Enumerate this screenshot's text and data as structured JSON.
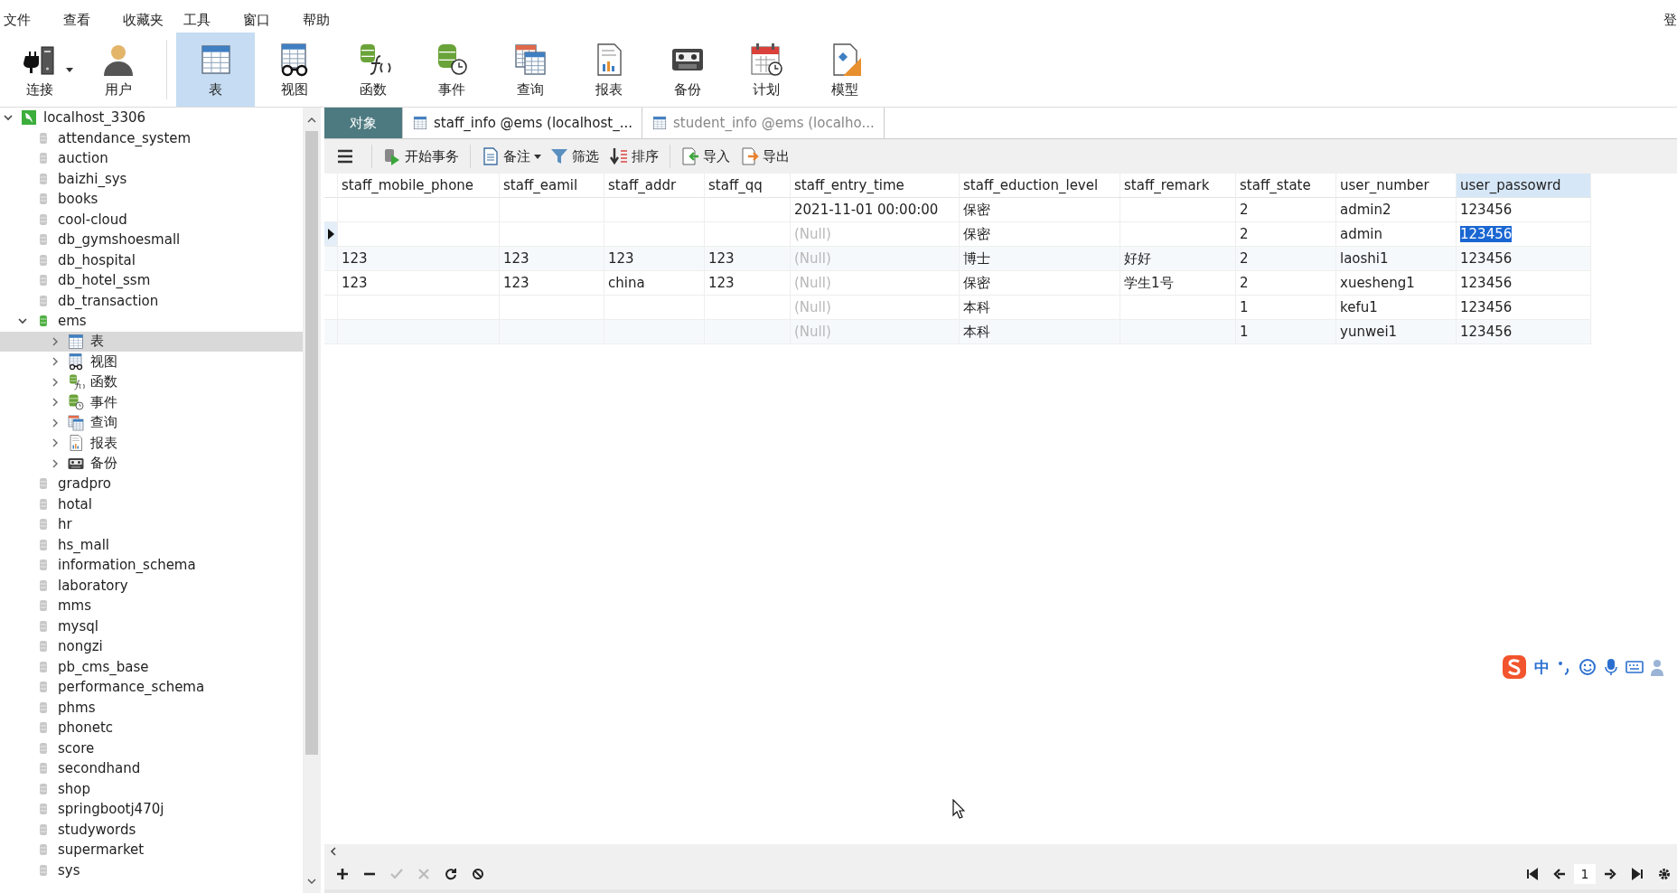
{
  "menu": [
    "文件",
    "查看",
    "收藏夹",
    "工具",
    "窗口",
    "帮助"
  ],
  "menu_right": "登",
  "toolbar": [
    {
      "label": "连接",
      "kind": "connect",
      "selected": false,
      "dropdown": true
    },
    {
      "label": "用户",
      "kind": "user",
      "selected": false
    },
    {
      "label": "表",
      "kind": "table",
      "selected": true
    },
    {
      "label": "视图",
      "kind": "view",
      "selected": false
    },
    {
      "label": "函数",
      "kind": "function",
      "selected": false
    },
    {
      "label": "事件",
      "kind": "event",
      "selected": false
    },
    {
      "label": "查询",
      "kind": "query",
      "selected": false
    },
    {
      "label": "报表",
      "kind": "report",
      "selected": false
    },
    {
      "label": "备份",
      "kind": "backup",
      "selected": false
    },
    {
      "label": "计划",
      "kind": "schedule",
      "selected": false
    },
    {
      "label": "模型",
      "kind": "model",
      "selected": false
    }
  ],
  "tree": {
    "label": "localhost_3306",
    "kind": "server",
    "expanded": true,
    "selected": false,
    "children": [
      {
        "label": "attendance_system",
        "kind": "db",
        "expanded": false,
        "selected": false
      },
      {
        "label": "auction",
        "kind": "db",
        "expanded": false,
        "selected": false
      },
      {
        "label": "baizhi_sys",
        "kind": "db",
        "expanded": false,
        "selected": false
      },
      {
        "label": "books",
        "kind": "db",
        "expanded": false,
        "selected": false
      },
      {
        "label": "cool-cloud",
        "kind": "db",
        "expanded": false,
        "selected": false
      },
      {
        "label": "db_gymshoesmall",
        "kind": "db",
        "expanded": false,
        "selected": false
      },
      {
        "label": "db_hospital",
        "kind": "db",
        "expanded": false,
        "selected": false
      },
      {
        "label": "db_hotel_ssm",
        "kind": "db",
        "expanded": false,
        "selected": false
      },
      {
        "label": "db_transaction",
        "kind": "db",
        "expanded": false,
        "selected": false
      },
      {
        "label": "ems",
        "kind": "db",
        "expanded": true,
        "selected": false,
        "children": [
          {
            "label": "表",
            "kind": "table",
            "expanded": false,
            "selected": true
          },
          {
            "label": "视图",
            "kind": "view",
            "expanded": false,
            "selected": false
          },
          {
            "label": "函数",
            "kind": "function",
            "expanded": false,
            "selected": false
          },
          {
            "label": "事件",
            "kind": "event",
            "expanded": false,
            "selected": false
          },
          {
            "label": "查询",
            "kind": "query",
            "expanded": false,
            "selected": false
          },
          {
            "label": "报表",
            "kind": "report",
            "expanded": false,
            "selected": false
          },
          {
            "label": "备份",
            "kind": "backup",
            "expanded": false,
            "selected": false
          }
        ]
      },
      {
        "label": "gradpro",
        "kind": "db",
        "expanded": false,
        "selected": false
      },
      {
        "label": "hotal",
        "kind": "db",
        "expanded": false,
        "selected": false
      },
      {
        "label": "hr",
        "kind": "db",
        "expanded": false,
        "selected": false
      },
      {
        "label": "hs_mall",
        "kind": "db",
        "expanded": false,
        "selected": false
      },
      {
        "label": "information_schema",
        "kind": "db",
        "expanded": false,
        "selected": false
      },
      {
        "label": "laboratory",
        "kind": "db",
        "expanded": false,
        "selected": false
      },
      {
        "label": "mms",
        "kind": "db",
        "expanded": false,
        "selected": false
      },
      {
        "label": "mysql",
        "kind": "db",
        "expanded": false,
        "selected": false
      },
      {
        "label": "nongzi",
        "kind": "db",
        "expanded": false,
        "selected": false
      },
      {
        "label": "pb_cms_base",
        "kind": "db",
        "expanded": false,
        "selected": false
      },
      {
        "label": "performance_schema",
        "kind": "db",
        "expanded": false,
        "selected": false
      },
      {
        "label": "phms",
        "kind": "db",
        "expanded": false,
        "selected": false
      },
      {
        "label": "phonetc",
        "kind": "db",
        "expanded": false,
        "selected": false
      },
      {
        "label": "score",
        "kind": "db",
        "expanded": false,
        "selected": false
      },
      {
        "label": "secondhand",
        "kind": "db",
        "expanded": false,
        "selected": false
      },
      {
        "label": "shop",
        "kind": "db",
        "expanded": false,
        "selected": false
      },
      {
        "label": "springbootj470j",
        "kind": "db",
        "expanded": false,
        "selected": false
      },
      {
        "label": "studywords",
        "kind": "db",
        "expanded": false,
        "selected": false
      },
      {
        "label": "supermarket",
        "kind": "db",
        "expanded": false,
        "selected": false
      },
      {
        "label": "sys",
        "kind": "db",
        "expanded": false,
        "selected": false
      }
    ]
  },
  "tabs": [
    {
      "label": "对象",
      "kind": "objects",
      "selected": false
    },
    {
      "label": "staff_info @ems (localhost_...",
      "kind": "table",
      "selected": true
    },
    {
      "label": "student_info @ems (localho...",
      "kind": "table",
      "selected": false
    }
  ],
  "tab_toolbar": [
    {
      "kind": "menu"
    },
    {
      "kind": "transaction",
      "label": "开始事务"
    },
    {
      "kind": "memo",
      "label": "备注",
      "dropdown": true
    },
    {
      "kind": "filter",
      "label": "筛选"
    },
    {
      "kind": "sort",
      "label": "排序"
    },
    {
      "kind": "import",
      "label": "导入"
    },
    {
      "kind": "export",
      "label": "导出"
    }
  ],
  "table": {
    "columns": [
      {
        "label": "staff_mobile_phone",
        "selected": false
      },
      {
        "label": "staff_eamil",
        "selected": false
      },
      {
        "label": "staff_addr",
        "selected": false
      },
      {
        "label": "staff_qq",
        "selected": false
      },
      {
        "label": "staff_entry_time",
        "selected": false
      },
      {
        "label": "staff_eduction_level",
        "selected": false
      },
      {
        "label": "staff_remark",
        "selected": false
      },
      {
        "label": "staff_state",
        "selected": false
      },
      {
        "label": "user_number",
        "selected": false
      },
      {
        "label": "user_passowrd",
        "selected": true
      }
    ],
    "rows": [
      {
        "current": false,
        "cells": [
          {
            "selected": false
          },
          {
            "selected": false
          },
          {
            "selected": false
          },
          {
            "selected": false
          },
          {
            "text": "2021-11-01 00:00:00",
            "null": false,
            "selected": false
          },
          {
            "text": "保密",
            "null": false,
            "selected": false
          },
          {
            "selected": false
          },
          {
            "text": "2",
            "null": false,
            "selected": false
          },
          {
            "text": "admin2",
            "null": false,
            "selected": false
          },
          {
            "text": "123456",
            "null": false,
            "selected": false
          }
        ]
      },
      {
        "current": true,
        "cells": [
          {
            "selected": false
          },
          {
            "selected": false
          },
          {
            "selected": false
          },
          {
            "selected": false
          },
          {
            "text": "(Null)",
            "null": true,
            "selected": false
          },
          {
            "text": "保密",
            "null": false,
            "selected": false
          },
          {
            "selected": false
          },
          {
            "text": "2",
            "null": false,
            "selected": false
          },
          {
            "text": "admin",
            "null": false,
            "selected": false
          },
          {
            "text": "123456",
            "null": false,
            "selected": true
          }
        ]
      },
      {
        "current": false,
        "cells": [
          {
            "text": "123",
            "null": false,
            "selected": false
          },
          {
            "text": "123",
            "null": false,
            "selected": false
          },
          {
            "text": "123",
            "null": false,
            "selected": false
          },
          {
            "text": "123",
            "null": false,
            "selected": false
          },
          {
            "text": "(Null)",
            "null": true,
            "selected": false
          },
          {
            "text": "博士",
            "null": false,
            "selected": false
          },
          {
            "text": "好好",
            "null": false,
            "selected": false
          },
          {
            "text": "2",
            "null": false,
            "selected": false
          },
          {
            "text": "laoshi1",
            "null": false,
            "selected": false
          },
          {
            "text": "123456",
            "null": false,
            "selected": false
          }
        ]
      },
      {
        "current": false,
        "cells": [
          {
            "text": "123",
            "null": false,
            "selected": false
          },
          {
            "text": "123",
            "null": false,
            "selected": false
          },
          {
            "text": "china",
            "null": false,
            "selected": false
          },
          {
            "text": "123",
            "null": false,
            "selected": false
          },
          {
            "text": "(Null)",
            "null": true,
            "selected": false
          },
          {
            "text": "保密",
            "null": false,
            "selected": false
          },
          {
            "text": "学生1号",
            "null": false,
            "selected": false
          },
          {
            "text": "2",
            "null": false,
            "selected": false
          },
          {
            "text": "xuesheng1",
            "null": false,
            "selected": false
          },
          {
            "text": "123456",
            "null": false,
            "selected": false
          }
        ]
      },
      {
        "current": false,
        "cells": [
          {
            "selected": false
          },
          {
            "selected": false
          },
          {
            "selected": false
          },
          {
            "selected": false
          },
          {
            "text": "(Null)",
            "null": true,
            "selected": false
          },
          {
            "text": "本科",
            "null": false,
            "selected": false
          },
          {
            "selected": false
          },
          {
            "text": "1",
            "null": false,
            "selected": false
          },
          {
            "text": "kefu1",
            "null": false,
            "selected": false
          },
          {
            "text": "123456",
            "null": false,
            "selected": false
          }
        ]
      },
      {
        "current": false,
        "cells": [
          {
            "selected": false
          },
          {
            "selected": false
          },
          {
            "selected": false
          },
          {
            "selected": false
          },
          {
            "text": "(Null)",
            "null": true,
            "selected": false
          },
          {
            "text": "本科",
            "null": false,
            "selected": false
          },
          {
            "selected": false
          },
          {
            "text": "1",
            "null": false,
            "selected": false
          },
          {
            "text": "yunwei1",
            "null": false,
            "selected": false
          },
          {
            "text": "123456",
            "null": false,
            "selected": false
          }
        ]
      }
    ]
  },
  "bottom_buttons": [
    {
      "kind": "add",
      "disabled": false
    },
    {
      "kind": "remove",
      "disabled": false
    },
    {
      "kind": "apply",
      "disabled": true
    },
    {
      "kind": "discard",
      "disabled": true
    },
    {
      "kind": "refresh",
      "disabled": false
    },
    {
      "kind": "stop",
      "disabled": false
    }
  ],
  "pager": {
    "page": "1"
  },
  "ime": {
    "label": "中"
  }
}
